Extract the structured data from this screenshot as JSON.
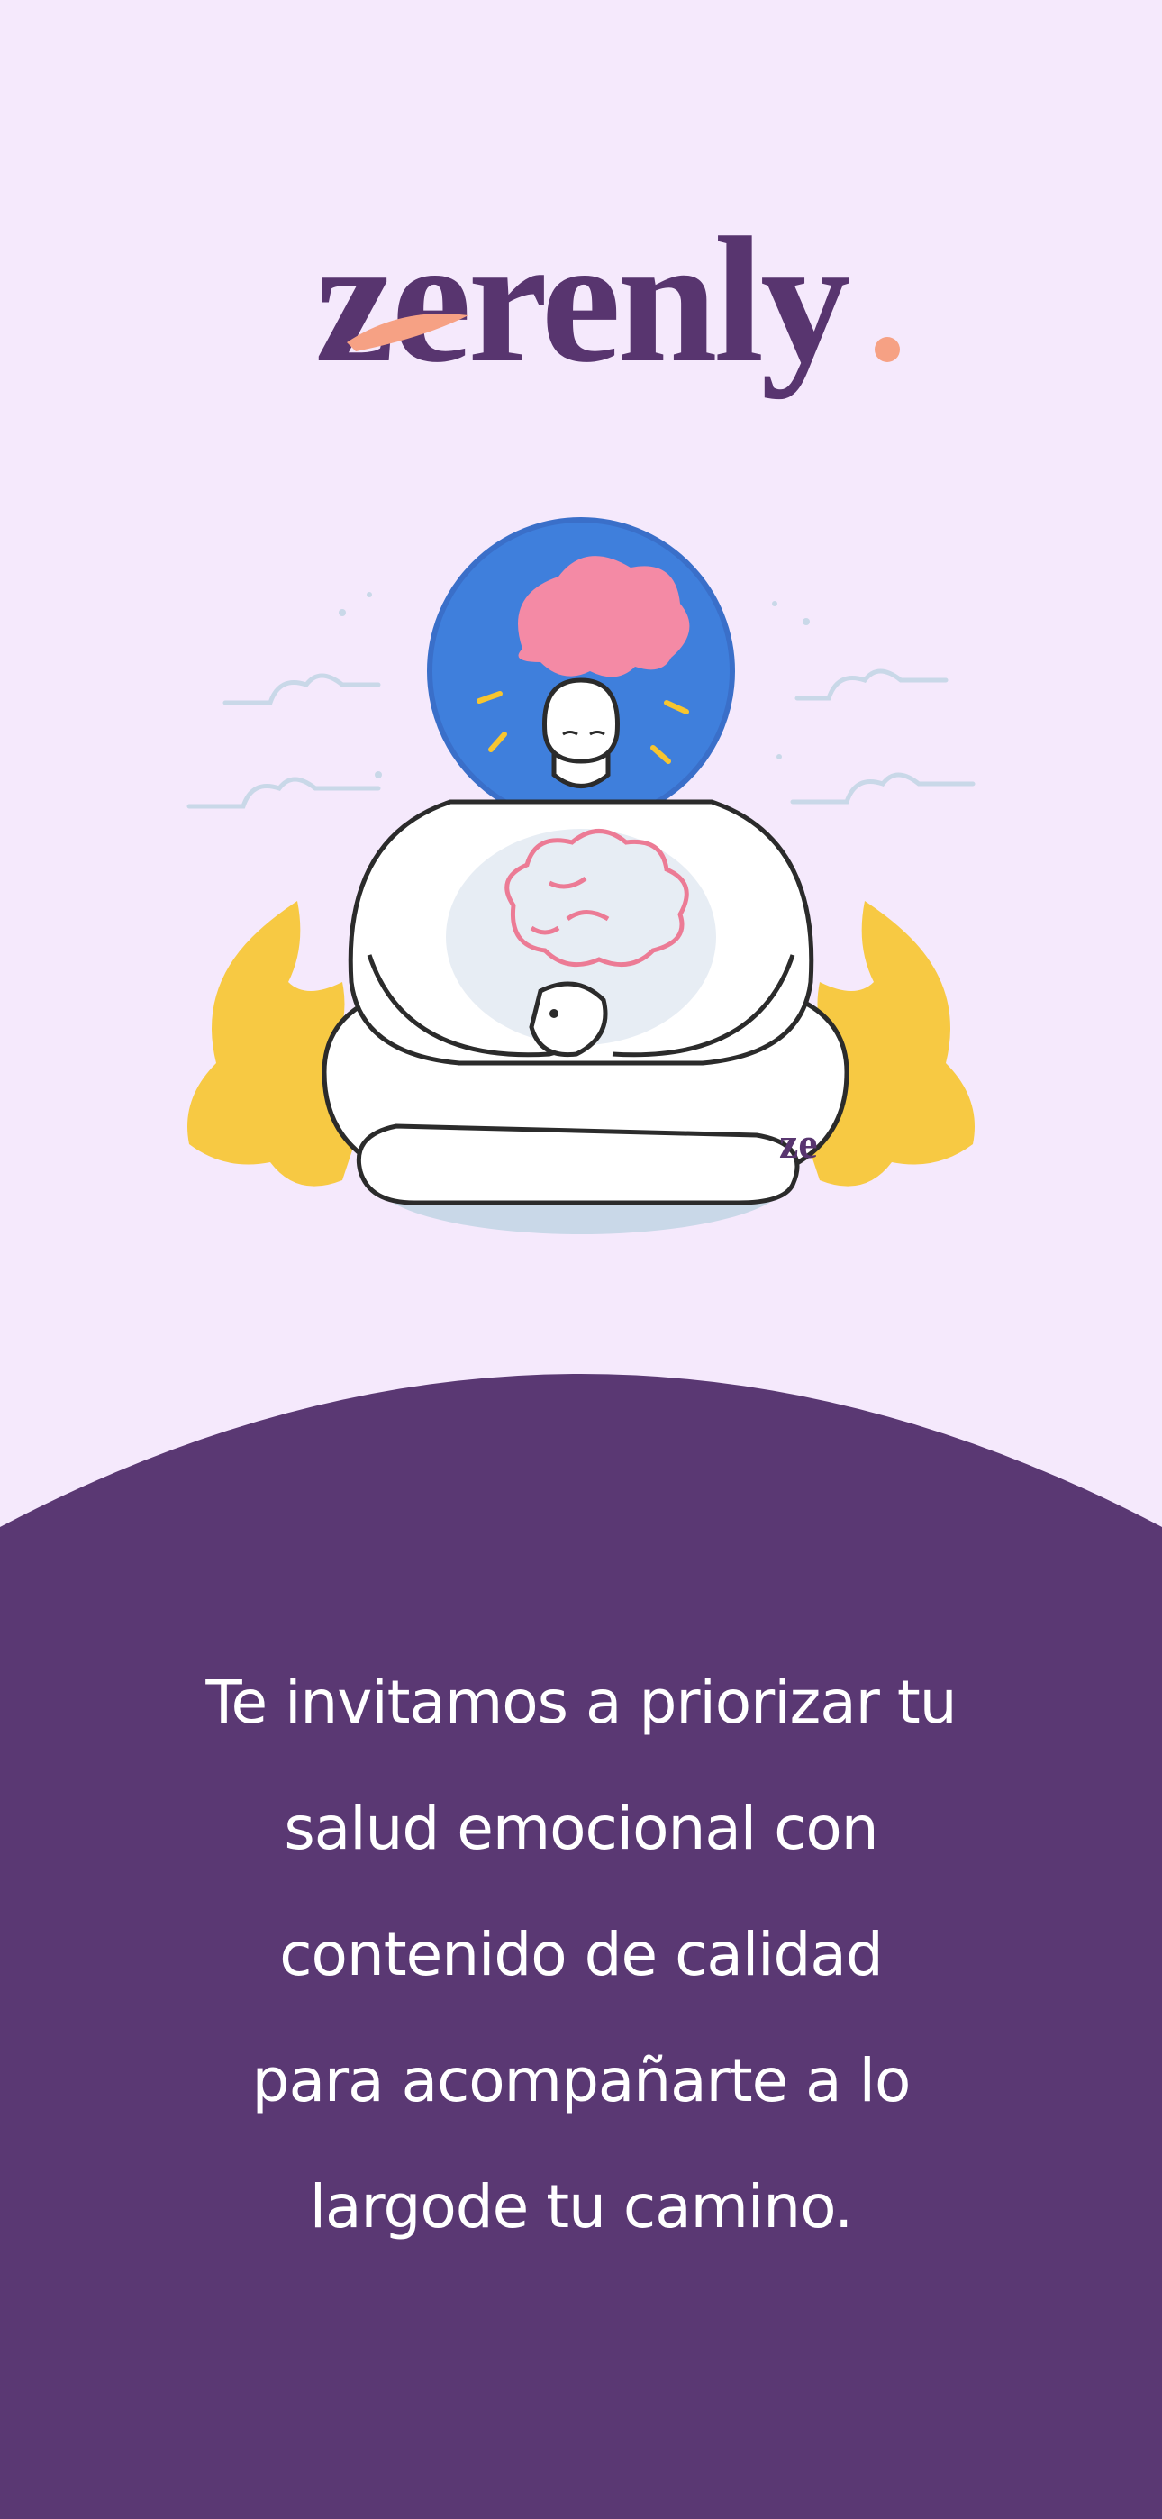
{
  "app": {
    "brand_name": "zerenly",
    "brand_color": "#58356f",
    "accent_color": "#f6a184",
    "background_color": "#f5e9fc"
  },
  "illustration": {
    "description_icon": "meditation-illustration-icon",
    "badge_text": "ze"
  },
  "onboarding": {
    "panel_color": "#5a3873",
    "message_lines": [
      "Te invitamos a priorizar tu",
      "salud emocional con",
      "contenido de calidad",
      "para acompañarte a lo",
      "largode tu camino."
    ]
  }
}
